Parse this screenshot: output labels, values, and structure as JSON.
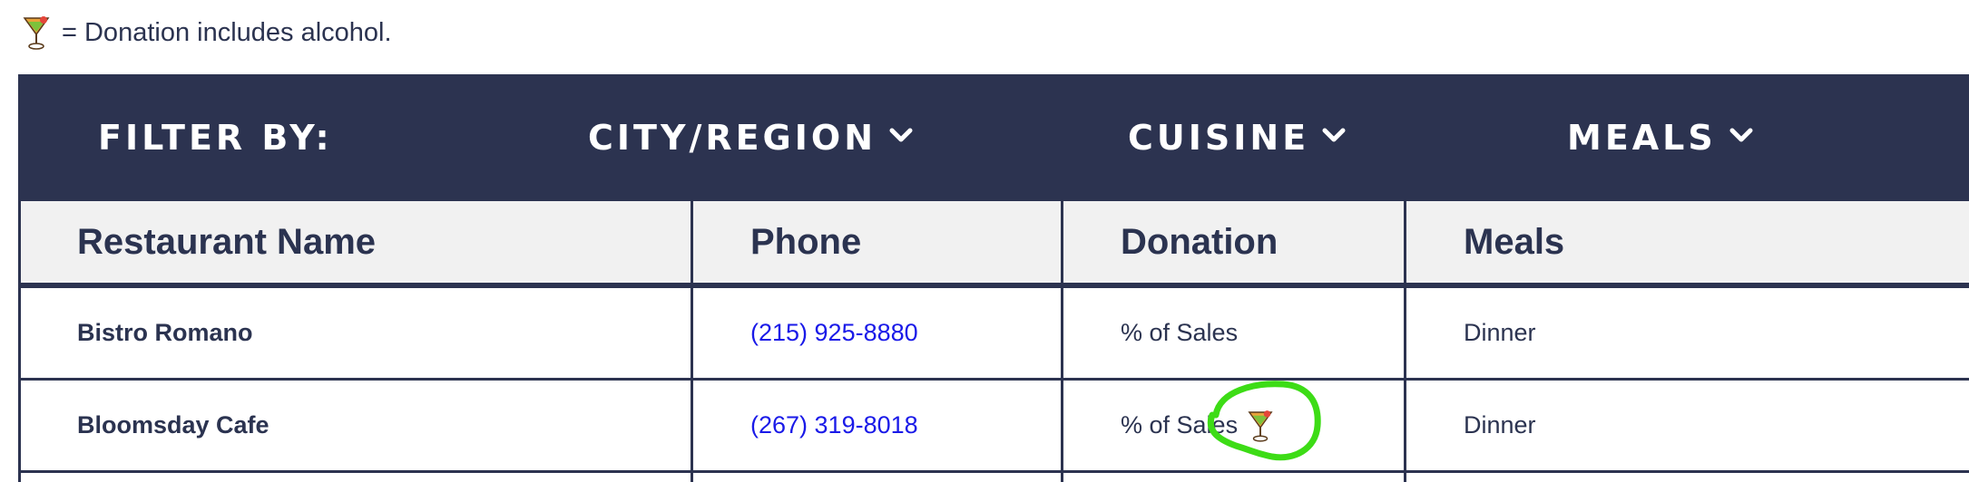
{
  "legend": {
    "icon": "cocktail-icon",
    "text": "= Donation includes alcohol."
  },
  "filter_bar": {
    "label": "FILTER BY:",
    "filters": [
      {
        "label": "CITY/REGION",
        "icon": "chevron-down-icon"
      },
      {
        "label": "CUISINE",
        "icon": "chevron-down-icon"
      },
      {
        "label": "MEALS",
        "icon": "chevron-down-icon"
      }
    ]
  },
  "table": {
    "columns": [
      "Restaurant Name",
      "Phone",
      "Donation",
      "Meals"
    ],
    "rows": [
      {
        "name": "Bistro Romano",
        "phone": "(215) 925-8880",
        "donation": "% of Sales",
        "alcohol": false,
        "meals": "Dinner"
      },
      {
        "name": "Bloomsday Cafe",
        "phone": "(267) 319-8018",
        "donation": "% of Sales",
        "alcohol": true,
        "meals": "Dinner"
      }
    ]
  },
  "colors": {
    "navy": "#2c3350",
    "link_blue": "#1a1ae8",
    "header_bg": "#f1f1f1",
    "highlight_green": "#3ddc16"
  }
}
